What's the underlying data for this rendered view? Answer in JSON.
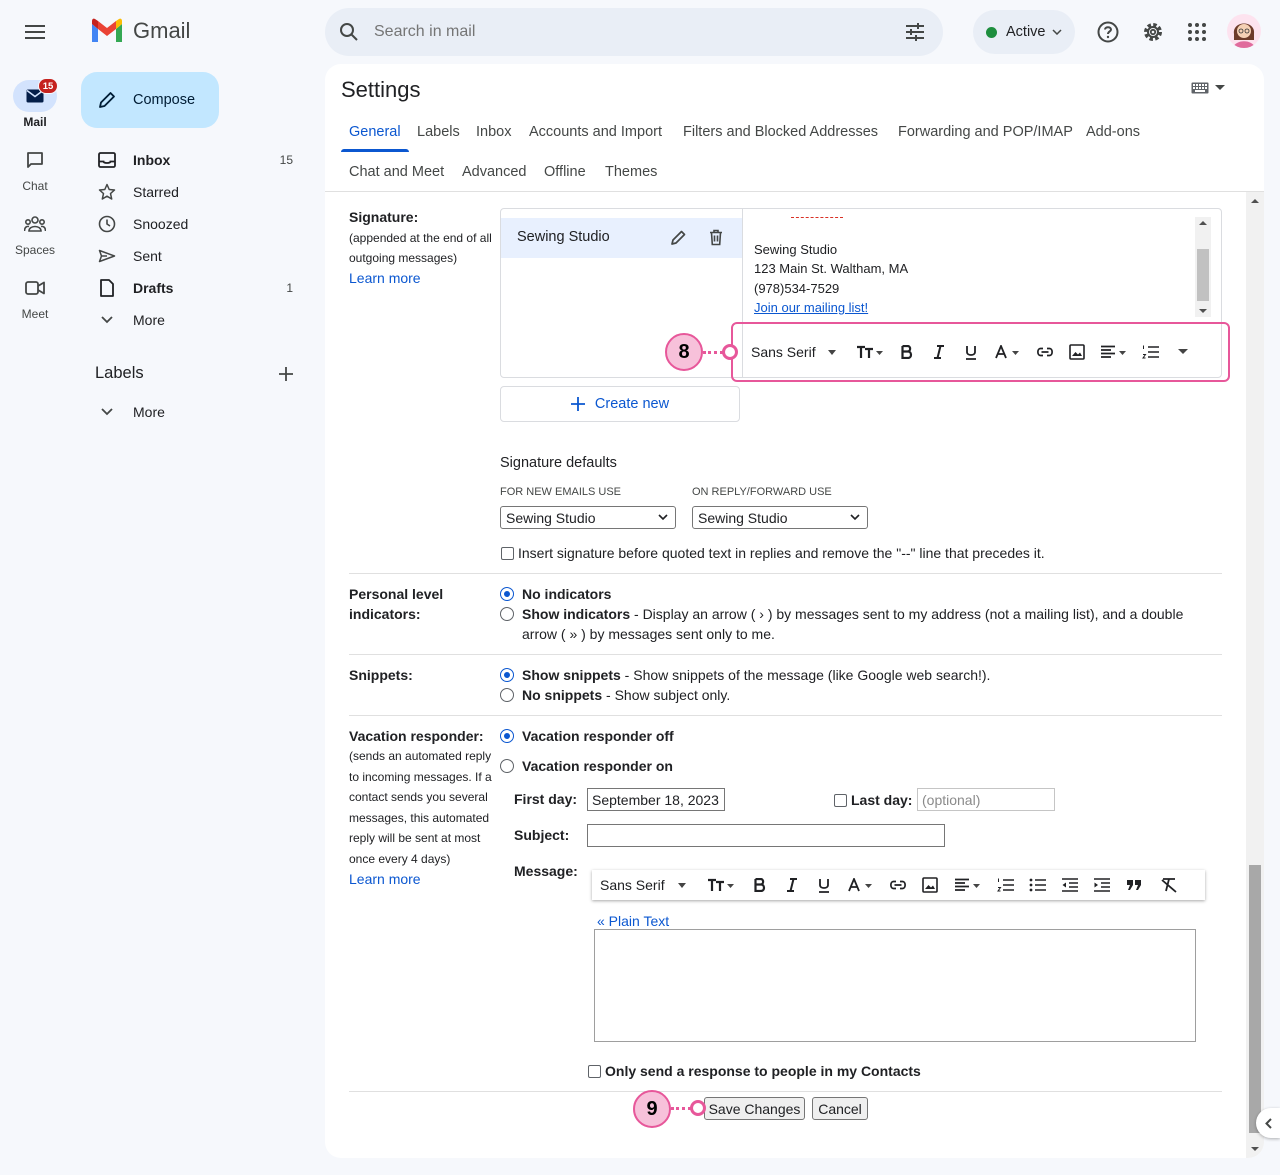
{
  "app": {
    "name": "Gmail"
  },
  "search": {
    "placeholder": "Search in mail"
  },
  "status": {
    "label": "Active"
  },
  "rail": {
    "mail": {
      "label": "Mail",
      "badge": "15"
    },
    "chat": {
      "label": "Chat"
    },
    "spaces": {
      "label": "Spaces"
    },
    "meet": {
      "label": "Meet"
    }
  },
  "compose": {
    "label": "Compose"
  },
  "nav": {
    "inbox": {
      "label": "Inbox",
      "count": "15"
    },
    "starred": {
      "label": "Starred"
    },
    "snoozed": {
      "label": "Snoozed"
    },
    "sent": {
      "label": "Sent"
    },
    "drafts": {
      "label": "Drafts",
      "count": "1"
    },
    "more": {
      "label": "More"
    },
    "labels_title": "Labels",
    "labels_more": "More"
  },
  "settings": {
    "title": "Settings",
    "tabs_row1": [
      "General",
      "Labels",
      "Inbox",
      "Accounts and Import",
      "Filters and Blocked Addresses",
      "Forwarding and POP/IMAP",
      "Add-ons"
    ],
    "tabs_row2": [
      "Chat and Meet",
      "Advanced",
      "Offline",
      "Themes"
    ],
    "active_tab": "General"
  },
  "signature": {
    "label": "Signature:",
    "desc1": "(appended at the end of all",
    "desc2": "outgoing messages)",
    "learn_more": "Learn more",
    "item_name": "Sewing Studio",
    "lines": [
      "Sewing Studio",
      "123 Main St. Waltham, MA",
      "(978)534-7529"
    ],
    "link": "Join our mailing list!",
    "create_new": "Create new",
    "toolbar_font": "Sans Serif",
    "defaults_title": "Signature defaults",
    "new_label": "FOR NEW EMAILS USE",
    "new_value": "Sewing Studio",
    "reply_label": "ON REPLY/FORWARD USE",
    "reply_value": "Sewing Studio",
    "insert_before": "Insert signature before quoted text in replies and remove the \"--\" line that precedes it."
  },
  "indicators": {
    "label1": "Personal level",
    "label2": "indicators:",
    "opt1": "No indicators",
    "opt2": "Show indicators",
    "opt2_desc": " - Display an arrow ( › ) by messages sent to my address (not a mailing list), and a double",
    "opt2_desc2": "arrow ( » ) by messages sent only to me."
  },
  "snippets": {
    "label": "Snippets:",
    "opt1": "Show snippets",
    "opt1_desc": " - Show snippets of the message (like Google web search!).",
    "opt2": "No snippets",
    "opt2_desc": " - Show subject only."
  },
  "vacation": {
    "label": "Vacation responder:",
    "desc": [
      "(sends an automated reply",
      "to incoming messages. If a",
      "contact sends you several",
      "messages, this automated",
      "reply will be sent at most",
      "once every 4 days)"
    ],
    "learn_more": "Learn more",
    "off": "Vacation responder off",
    "on": "Vacation responder on",
    "first_day_label": "First day:",
    "first_day_value": "September 18, 2023",
    "last_day_label": "Last day:",
    "last_day_placeholder": "(optional)",
    "subject_label": "Subject:",
    "message_label": "Message:",
    "toolbar_font": "Sans Serif",
    "plain_text": "« Plain Text",
    "contacts_only": "Only send a response to people in my Contacts"
  },
  "actions": {
    "save": "Save Changes",
    "cancel": "Cancel"
  },
  "callouts": {
    "first": "8",
    "second": "9"
  }
}
